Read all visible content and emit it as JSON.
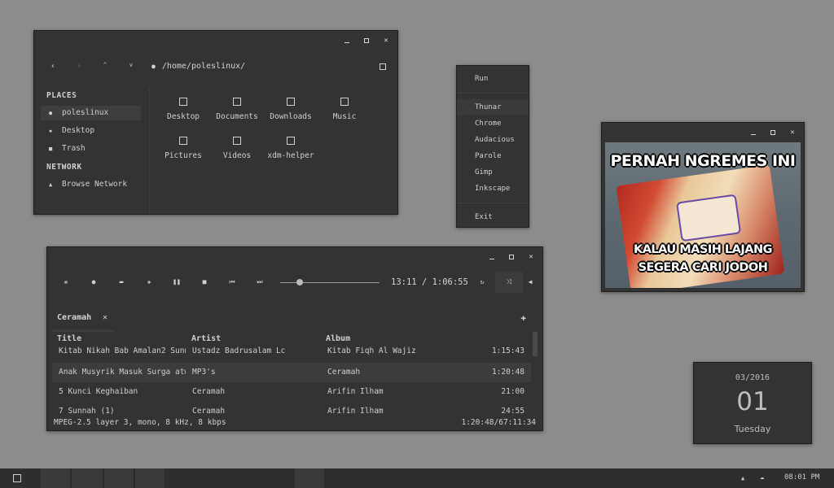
{
  "file_manager": {
    "path": "/home/poleslinux/",
    "places_heading": "PLACES",
    "network_heading": "NETWORK",
    "places": [
      "poleslinux",
      "Desktop",
      "Trash"
    ],
    "network": [
      "Browse Network"
    ],
    "folders": [
      "Desktop",
      "Documents",
      "Downloads",
      "Music",
      "Pictures",
      "Videos",
      "xdm-helper"
    ]
  },
  "menu": {
    "items_top": [
      "Run"
    ],
    "items_mid": [
      "Thunar",
      "Chrome",
      "Audacious",
      "Parole",
      "Gimp",
      "Inkscape"
    ],
    "items_bottom": [
      "Exit"
    ]
  },
  "image_viewer": {
    "caption_top": "PERNAH NGREMES INI",
    "caption_bottom_1": "KALAU MASIH LAJANG",
    "caption_bottom_2": "SEGERA CARI JODOH"
  },
  "player": {
    "time": "13:11 / 1:06:55",
    "progress": 0.2,
    "tab_label": "Ceramah",
    "columns": [
      "Title",
      "Artist",
      "Album"
    ],
    "tracks": [
      {
        "title": "Kitab Nikah Bab Amalan2 Sunna…",
        "artist": "Ustadz Badrusalam Lc",
        "album": "Kitab Fiqh Al Wajiz",
        "length": "1:15:43"
      },
      {
        "title": "Anak Musyrik Masuk Surga atw …",
        "artist": "MP3's",
        "album": "Ceramah",
        "length": "1:20:48"
      },
      {
        "title": "5 Kunci Keghaiban",
        "artist": "Ceramah",
        "album": "Arifin Ilham",
        "length": "21:00"
      },
      {
        "title": "7 Sunnah (1)",
        "artist": "Ceramah",
        "album": "Arifin Ilham",
        "length": "24:55"
      }
    ],
    "status_left": "MPEG-2.5 layer 3, mono, 8 kHz, 8 kbps",
    "status_right": "1:20:48/67:11:34"
  },
  "clock": {
    "month_year": "03/2016",
    "day": "01",
    "weekday": "Tuesday"
  },
  "taskbar": {
    "time": "08:01 PM"
  }
}
